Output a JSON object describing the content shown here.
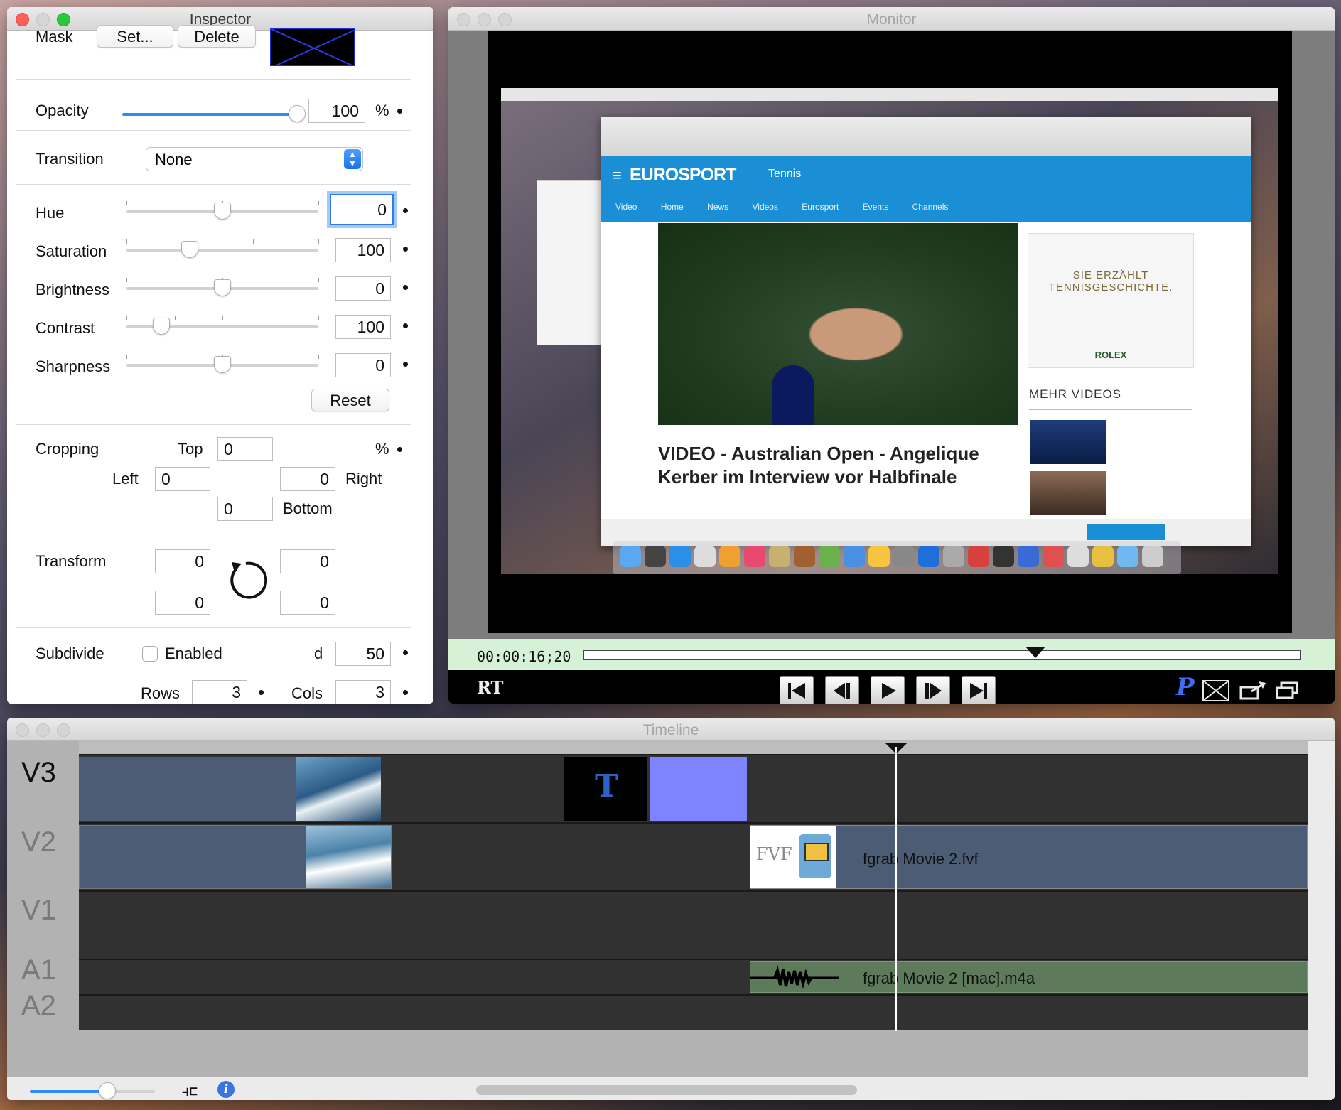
{
  "inspector": {
    "title": "Inspector",
    "mask_label": "Mask",
    "mask_set": "Set...",
    "mask_delete": "Delete",
    "opacity_label": "Opacity",
    "opacity_value": "100",
    "opacity_level": 1.0,
    "percent": "%",
    "transition_label": "Transition",
    "transition_value": "None",
    "hue_label": "Hue",
    "hue_value": "0",
    "saturation_label": "Saturation",
    "saturation_value": "100",
    "brightness_label": "Brightness",
    "brightness_value": "0",
    "contrast_label": "Contrast",
    "contrast_value": "100",
    "sharpness_label": "Sharpness",
    "sharpness_value": "0",
    "reset": "Reset",
    "cropping_label": "Cropping",
    "top_label": "Top",
    "top_value": "0",
    "left_label": "Left",
    "left_value": "0",
    "right_label": "Right",
    "right_value": "0",
    "bottom_label": "Bottom",
    "bottom_value": "0",
    "transform_label": "Transform",
    "transform_values": [
      "0",
      "0",
      "0",
      "0"
    ],
    "subdivide_label": "Subdivide",
    "enabled_label": "Enabled",
    "d_label": "d",
    "d_value": "50",
    "rows_label": "Rows",
    "rows_value": "3",
    "cols_label": "Cols",
    "cols_value": "3"
  },
  "monitor": {
    "title": "Monitor",
    "timecode": "00:00:16;20",
    "playhead_fraction": 0.63,
    "rt_label": "RT",
    "p_label": "P",
    "buttons": [
      "skip-to-start-icon",
      "step-back-icon",
      "play-icon",
      "step-forward-icon",
      "skip-to-end-icon"
    ],
    "video": {
      "site_logo": "EUROSPORT",
      "section": "Tennis",
      "nav": "Video Home  News Videos  Eurosport Events  Channels",
      "headline": "VIDEO - Australian Open - Angelique Kerber im Interview vor Halbfinale",
      "ad_text": "SIE ERZÄHLT TENNISGESCHICHTE.",
      "ad_brand": "ROLEX",
      "mehr_videos": "MEHR VIDEOS"
    }
  },
  "timeline": {
    "title": "Timeline",
    "tracks": [
      "V3",
      "V2",
      "V1",
      "A1",
      "A2"
    ],
    "clip_t_label": "T",
    "fvf_label": "FVF",
    "clip_v2_name": "fgrab Movie 2.fvf",
    "clip_a1_name": "fgrab Movie 2 [mac].m4a",
    "zoom_level": 0.62
  }
}
